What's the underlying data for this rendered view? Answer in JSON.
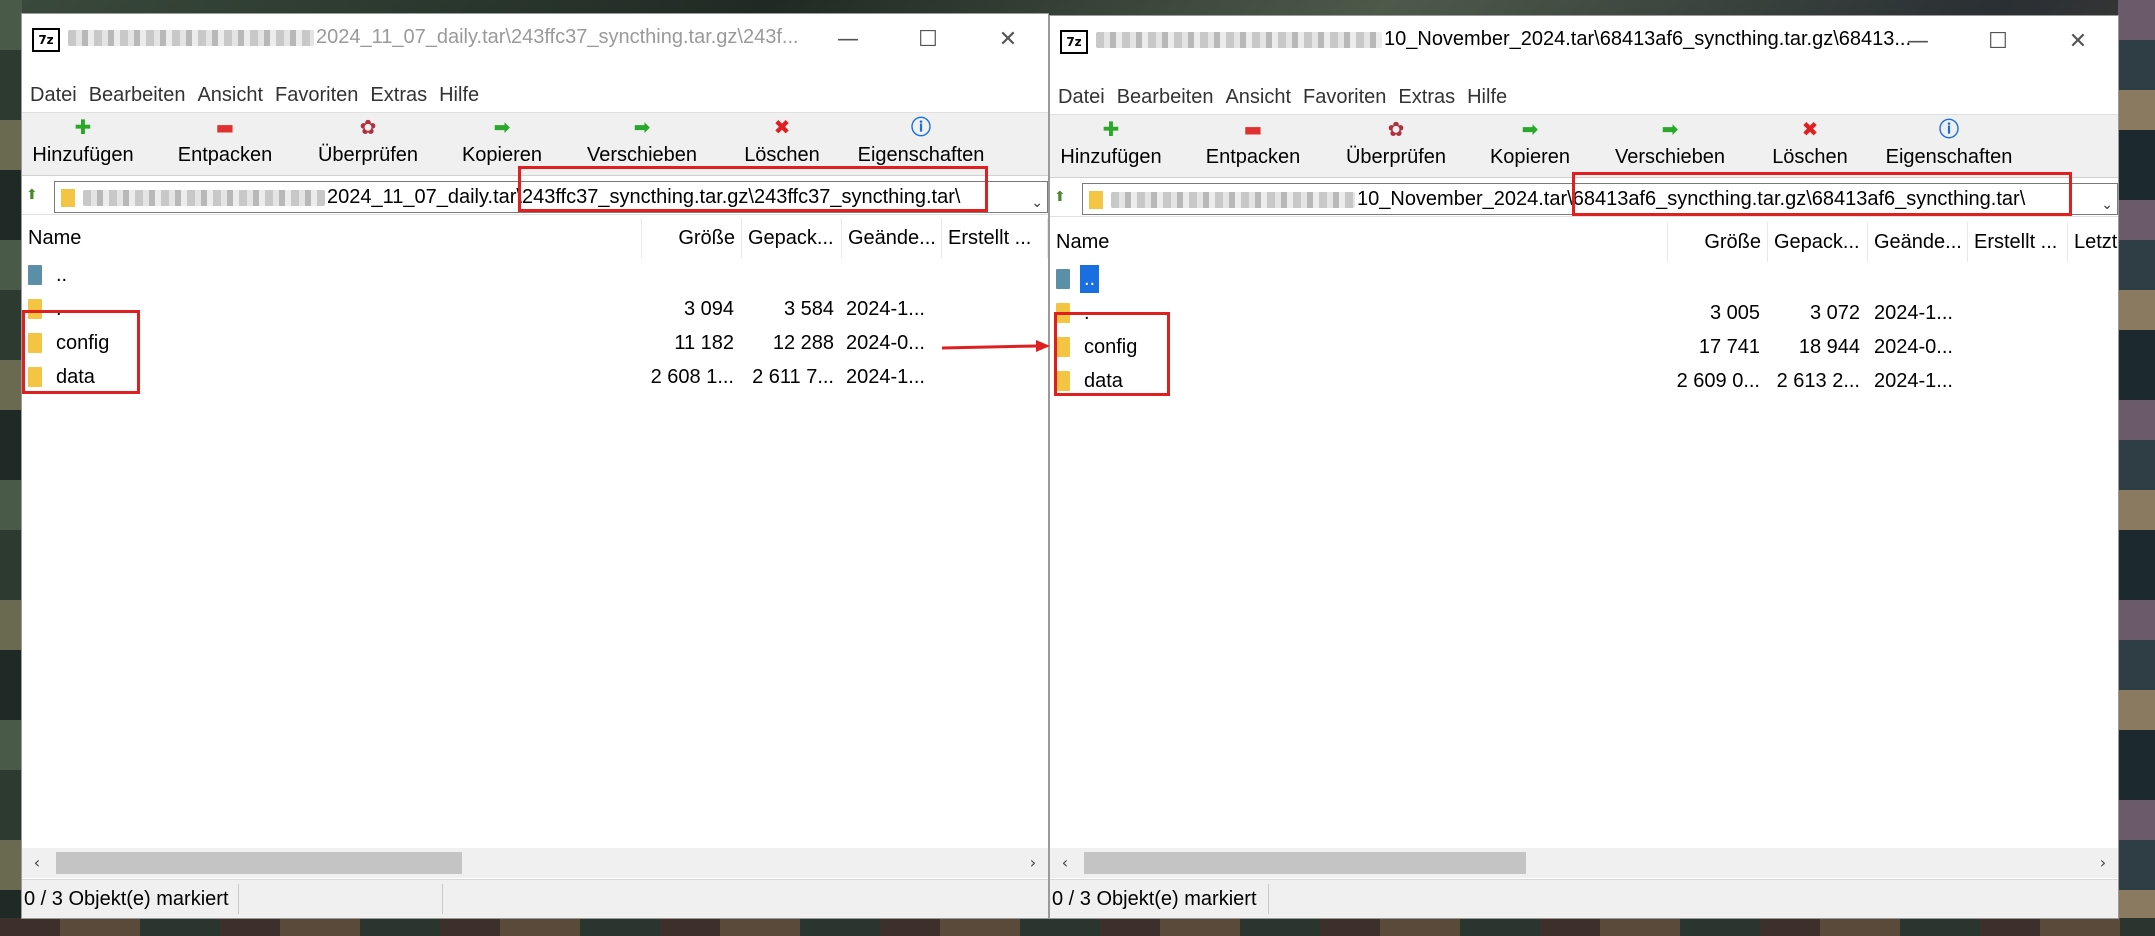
{
  "windows": [
    {
      "title_path": "2024_11_07_daily.tar\\243ffc37_syncthing.tar.gz\\243f...",
      "menu": [
        "Datei",
        "Bearbeiten",
        "Ansicht",
        "Favoriten",
        "Extras",
        "Hilfe"
      ],
      "toolbar": [
        {
          "label": "Hinzufügen",
          "icon": "add-icon"
        },
        {
          "label": "Entpacken",
          "icon": "extract-icon"
        },
        {
          "label": "Überprüfen",
          "icon": "test-icon"
        },
        {
          "label": "Kopieren",
          "icon": "copy-icon"
        },
        {
          "label": "Verschieben",
          "icon": "move-icon"
        },
        {
          "label": "Löschen",
          "icon": "delete-icon"
        },
        {
          "label": "Eigenschaften",
          "icon": "info-icon"
        }
      ],
      "address_prefix": "2024_11_07_daily.tar",
      "address_highlight": "\\243ffc37_syncthing.tar.gz\\243ffc37_syncthing.tar\\",
      "columns": [
        "Name",
        "Größe",
        "Gepack...",
        "Geände...",
        "Erstellt ..."
      ],
      "rows": [
        {
          "name": "..",
          "size": "",
          "packed": "",
          "modified": "",
          "type": "up"
        },
        {
          "name": ".",
          "size": "3 094",
          "packed": "3 584",
          "modified": "2024-1...",
          "type": "folder"
        },
        {
          "name": "config",
          "size": "11 182",
          "packed": "12 288",
          "modified": "2024-0...",
          "type": "folder"
        },
        {
          "name": "data",
          "size": "2 608 1...",
          "packed": "2 611 7...",
          "modified": "2024-1...",
          "type": "folder"
        }
      ],
      "status": "0 / 3 Objekt(e) markiert"
    },
    {
      "title_path": "10_November_2024.tar\\68413af6_syncthing.tar.gz\\68413...",
      "menu": [
        "Datei",
        "Bearbeiten",
        "Ansicht",
        "Favoriten",
        "Extras",
        "Hilfe"
      ],
      "toolbar": [
        {
          "label": "Hinzufügen",
          "icon": "add-icon"
        },
        {
          "label": "Entpacken",
          "icon": "extract-icon"
        },
        {
          "label": "Überprüfen",
          "icon": "test-icon"
        },
        {
          "label": "Kopieren",
          "icon": "copy-icon"
        },
        {
          "label": "Verschieben",
          "icon": "move-icon"
        },
        {
          "label": "Löschen",
          "icon": "delete-icon"
        },
        {
          "label": "Eigenschaften",
          "icon": "info-icon"
        }
      ],
      "address_prefix": "10_November_2024.tar",
      "address_highlight": "\\68413af6_syncthing.tar.gz\\68413af6_syncthing.tar\\",
      "columns": [
        "Name",
        "Größe",
        "Gepack...",
        "Geände...",
        "Erstellt ...",
        "Letzt"
      ],
      "rows": [
        {
          "name": "..",
          "size": "",
          "packed": "",
          "modified": "",
          "type": "up"
        },
        {
          "name": ".",
          "size": "3 005",
          "packed": "3 072",
          "modified": "2024-1...",
          "type": "folder"
        },
        {
          "name": "config",
          "size": "17 741",
          "packed": "18 944",
          "modified": "2024-0...",
          "type": "folder"
        },
        {
          "name": "data",
          "size": "2 609 0...",
          "packed": "2 613 2...",
          "modified": "2024-1...",
          "type": "folder"
        }
      ],
      "status": "0 / 3 Objekt(e) markiert"
    }
  ],
  "window_controls": {
    "minimize": "—",
    "maximize": "☐",
    "close": "✕"
  },
  "app_icon_text": "7z",
  "colors": {
    "highlight": "#e02020",
    "selection": "#1a6fe0",
    "folder": "#f4c542"
  }
}
